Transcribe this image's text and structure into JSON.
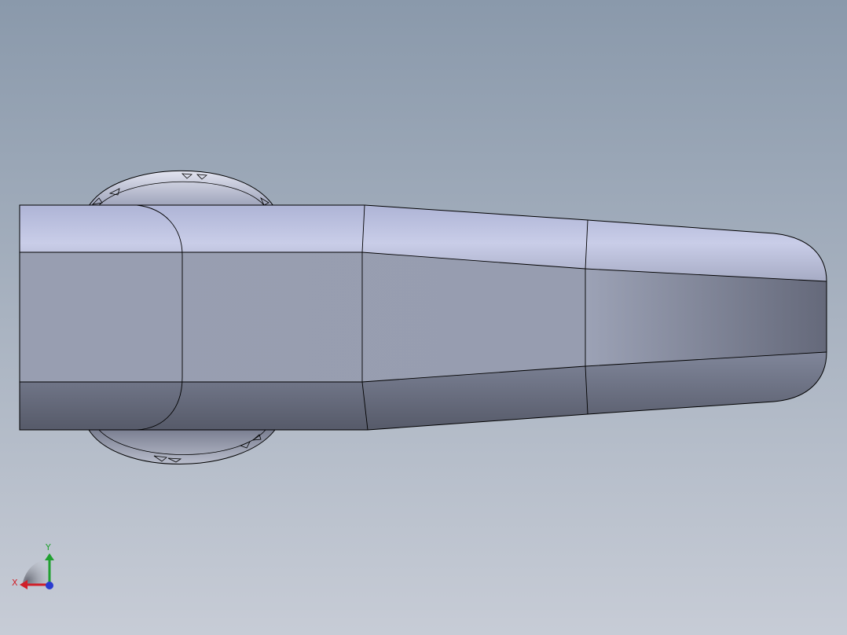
{
  "viewport": {
    "background_top": "#8a99ab",
    "background_bottom": "#c7ccd6"
  },
  "model": {
    "face_light": "#c9cde8",
    "face_mid": "#989eb1",
    "face_dark": "#5e6272",
    "edge_color": "#000000"
  },
  "triad": {
    "x_label": "X",
    "y_label": "Y",
    "x_color": "#d0202a",
    "y_color": "#20a030",
    "z_color": "#2a3bd0"
  }
}
